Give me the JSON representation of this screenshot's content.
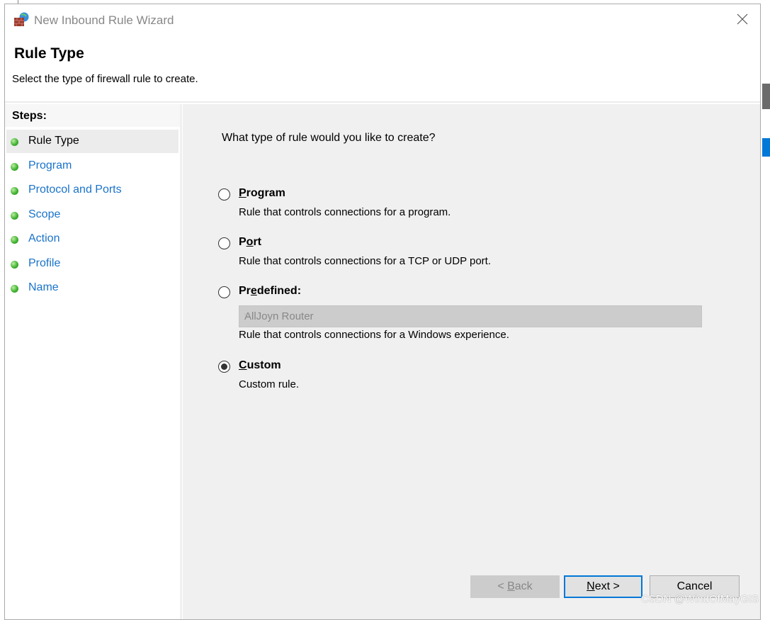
{
  "window": {
    "title": "New Inbound Rule Wizard",
    "icon": "firewall-globe-icon"
  },
  "header": {
    "title": "Rule Type",
    "subtitle": "Select the type of firewall rule to create."
  },
  "steps": {
    "heading": "Steps:",
    "items": [
      {
        "label": "Rule Type",
        "active": true
      },
      {
        "label": "Program"
      },
      {
        "label": "Protocol and Ports"
      },
      {
        "label": "Scope"
      },
      {
        "label": "Action"
      },
      {
        "label": "Profile"
      },
      {
        "label": "Name"
      }
    ]
  },
  "main": {
    "question": "What type of rule would you like to create?",
    "options": [
      {
        "pre": "",
        "key": "P",
        "post": "rogram",
        "description": "Rule that controls connections for a program.",
        "selected": false
      },
      {
        "pre": "P",
        "key": "o",
        "post": "rt",
        "description": "Rule that controls connections for a TCP or UDP port.",
        "selected": false
      },
      {
        "pre": "Pr",
        "key": "e",
        "post": "defined:",
        "description": "Rule that controls connections for a Windows experience.",
        "selected": false,
        "dropdown_value": "AllJoyn Router"
      },
      {
        "pre": "",
        "key": "C",
        "post": "ustom",
        "description": "Custom rule.",
        "selected": true
      }
    ]
  },
  "buttons": {
    "back_pre": "< ",
    "back_key": "B",
    "back_post": "ack",
    "next_key": "N",
    "next_post": "ext >",
    "cancel": "Cancel"
  },
  "watermark": "CSDN @WindOfMayGIS",
  "colors": {
    "accent": "#0078d7",
    "link": "#1a73c9",
    "panel": "#f0f0f0"
  }
}
